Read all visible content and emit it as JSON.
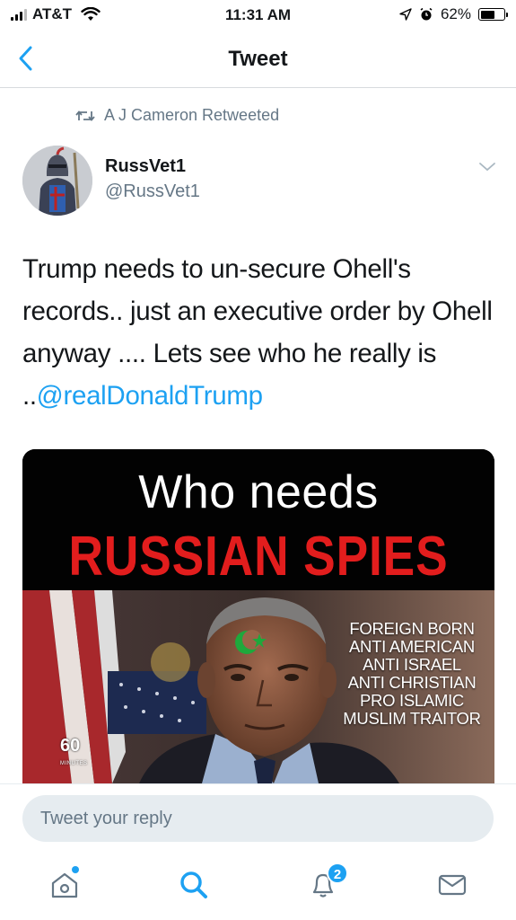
{
  "status_bar": {
    "carrier": "AT&T",
    "time": "11:31 AM",
    "battery_percent": "62%",
    "battery_level": 0.62
  },
  "nav": {
    "title": "Tweet",
    "back_icon": "chevron-left-icon"
  },
  "retweet": {
    "icon": "retweet-icon",
    "text": "A J Cameron Retweeted"
  },
  "author": {
    "name": "RussVet1",
    "handle": "@RussVet1"
  },
  "tweet": {
    "text": "Trump needs to un-secure Ohell's records.. just an executive order by Ohell anyway .... Lets see who he really is ..",
    "mention": "@realDonaldTrump"
  },
  "media": {
    "headline_line1": "Who needs",
    "headline_line2": "RUSSIAN SPIES",
    "caption_lines": [
      "FOREIGN BORN",
      "ANTI AMERICAN",
      "ANTI ISRAEL",
      "ANTI CHRISTIAN",
      "PRO ISLAMIC",
      "MUSLIM TRAITOR"
    ],
    "watermark": "60",
    "watermark_sub": "MINUTES",
    "headline_color": "#e21d1d"
  },
  "reply": {
    "placeholder": "Tweet your reply"
  },
  "tabbar": {
    "home_icon": "home-icon",
    "search_icon": "search-icon",
    "notifications_icon": "bell-icon",
    "notifications_badge": "2",
    "messages_icon": "envelope-icon"
  },
  "colors": {
    "accent": "#1da1f2",
    "secondary_text": "#657786"
  }
}
